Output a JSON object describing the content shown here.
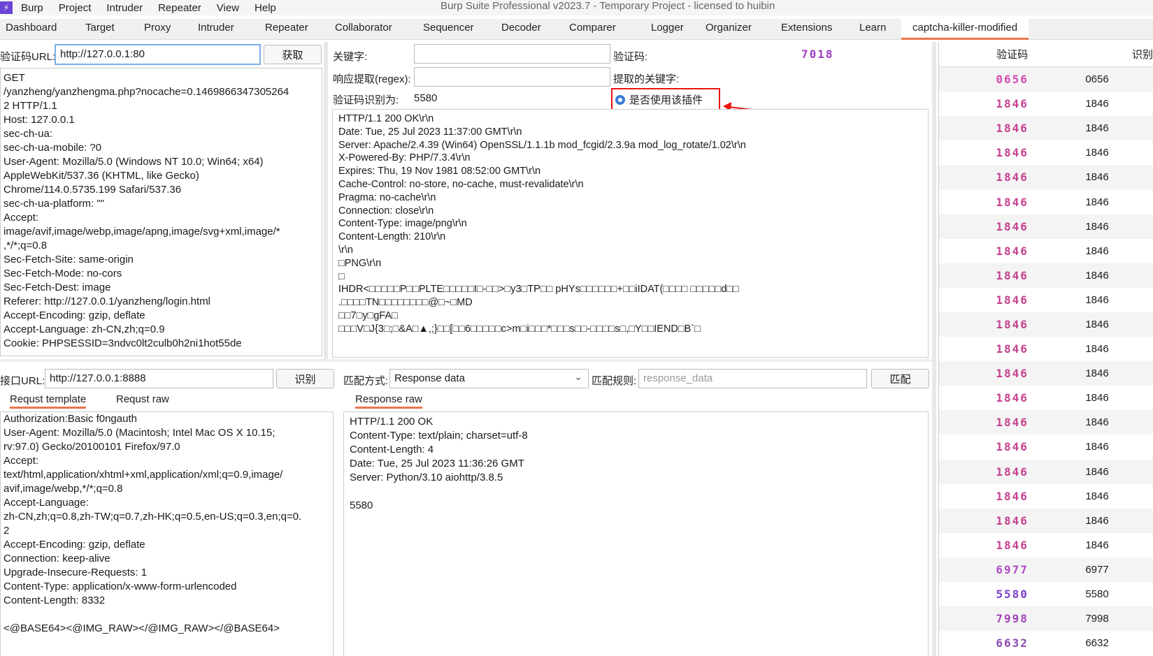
{
  "window_title": "Burp Suite Professional v2023.7 - Temporary Project - licensed to huibin",
  "menu": [
    "Burp",
    "Project",
    "Intruder",
    "Repeater",
    "View",
    "Help"
  ],
  "tabs": [
    "Dashboard",
    "Target",
    "Proxy",
    "Intruder",
    "Repeater",
    "Collaborator",
    "Sequencer",
    "Decoder",
    "Comparer",
    "Logger",
    "Organizer",
    "Extensions",
    "Learn",
    "captcha-killer-modified"
  ],
  "captcha_panel": {
    "url_label": "验证码URL:",
    "url_value": "http://127.0.0.1:80",
    "fetch_button": "获取",
    "request_text": "GET\n/yanzheng/yanzhengma.php?nocache=0.1469866347305264\n2 HTTP/1.1\nHost: 127.0.0.1\nsec-ch-ua:\nsec-ch-ua-mobile: ?0\nUser-Agent: Mozilla/5.0 (Windows NT 10.0; Win64; x64)\nAppleWebKit/537.36 (KHTML, like Gecko)\nChrome/114.0.5735.199 Safari/537.36\nsec-ch-ua-platform: \"\"\nAccept:\nimage/avif,image/webp,image/apng,image/svg+xml,image/*\n,*/*;q=0.8\nSec-Fetch-Site: same-origin\nSec-Fetch-Mode: no-cors\nSec-Fetch-Dest: image\nReferer: http://127.0.0.1/yanzheng/login.html\nAccept-Encoding: gzip, deflate\nAccept-Language: zh-CN,zh;q=0.9\nCookie: PHPSESSID=3ndvc0lt2culb0h2ni1hot55de"
  },
  "keyword_panel": {
    "keyword_label": "关键字:",
    "keyword_value": "",
    "captcha_label": "验证码:",
    "captcha_image_text": "7018",
    "regex_label": "响应提取(regex):",
    "regex_value": "",
    "extracted_label": "提取的关键字:",
    "recognized_label": "验证码识别为:",
    "recognized_value": "5580",
    "use_plugin_label": "是否使用该插件",
    "response_text": "HTTP/1.1 200 OK\\r\\n\nDate: Tue, 25 Jul 2023 11:37:00 GMT\\r\\n\nServer: Apache/2.4.39 (Win64) OpenSSL/1.1.1b mod_fcgid/2.3.9a mod_log_rotate/1.02\\r\\n\nX-Powered-By: PHP/7.3.4\\r\\n\nExpires: Thu, 19 Nov 1981 08:52:00 GMT\\r\\n\nCache-Control: no-store, no-cache, must-revalidate\\r\\n\nPragma: no-cache\\r\\n\nConnection: close\\r\\n\nContent-Type: image/png\\r\\n\nContent-Length: 210\\r\\n\n\\r\\n\n□PNG\\r\\n\n□\nIHDR<□□□□□P□□PLTE□□□□□I□-□□>□y3□TP□□ pHYs□□□□□□+□□iIDAT(□□□□ □□□□□d□□\n.□□□□TN□□□□□□□□@□~□MD\n□□7□y□gFA□\n□□□V□J{3□;□&A□▲,;}□□[□□6□□□□□c>m□i□□□*□□□s□□-□□□□s□,□Y□□IEND□B`□"
  },
  "api_panel": {
    "url_label": "接口URL:",
    "url_value": "http://127.0.0.1:8888",
    "recognize_button": "识别",
    "tab_template": "Requst template",
    "tab_raw": "Requst raw",
    "template_text": "Authorization:Basic f0ngauth\nUser-Agent: Mozilla/5.0 (Macintosh; Intel Mac OS X 10.15;\nrv:97.0) Gecko/20100101 Firefox/97.0\nAccept:\ntext/html,application/xhtml+xml,application/xml;q=0.9,image/\navif,image/webp,*/*;q=0.8\nAccept-Language:\nzh-CN,zh;q=0.8,zh-TW;q=0.7,zh-HK;q=0.5,en-US;q=0.3,en;q=0.\n2\nAccept-Encoding: gzip, deflate\nConnection: keep-alive\nUpgrade-Insecure-Requests: 1\nContent-Type: application/x-www-form-urlencoded\nContent-Length: 8332\n\n<@BASE64><@IMG_RAW></@IMG_RAW></@BASE64>"
  },
  "match_panel": {
    "match_mode_label": "匹配方式:",
    "match_mode_value": "Response data",
    "match_rule_label": "匹配规则:",
    "match_rule_placeholder": "response_data",
    "match_button": "匹配",
    "tab_response_raw": "Response raw",
    "response_text": "HTTP/1.1 200 OK\nContent-Type: text/plain; charset=utf-8\nContent-Length: 4\nDate: Tue, 25 Jul 2023 11:36:26 GMT\nServer: Python/3.10 aiohttp/3.8.5\n\n5580"
  },
  "history_table": {
    "col_captcha": "验证码",
    "col_result": "识别",
    "rows": [
      {
        "img": "0656",
        "val": "0656",
        "color": "#d44ab0"
      },
      {
        "img": "1846",
        "val": "1846",
        "color": "#c5408f"
      },
      {
        "img": "1846",
        "val": "1846",
        "color": "#c5408f"
      },
      {
        "img": "1846",
        "val": "1846",
        "color": "#c5408f"
      },
      {
        "img": "1846",
        "val": "1846",
        "color": "#c5408f"
      },
      {
        "img": "1846",
        "val": "1846",
        "color": "#c5408f"
      },
      {
        "img": "1846",
        "val": "1846",
        "color": "#c5408f"
      },
      {
        "img": "1846",
        "val": "1846",
        "color": "#c5408f"
      },
      {
        "img": "1846",
        "val": "1846",
        "color": "#c5408f"
      },
      {
        "img": "1846",
        "val": "1846",
        "color": "#c5408f"
      },
      {
        "img": "1846",
        "val": "1846",
        "color": "#c5408f"
      },
      {
        "img": "1846",
        "val": "1846",
        "color": "#c5408f"
      },
      {
        "img": "1846",
        "val": "1846",
        "color": "#c5408f"
      },
      {
        "img": "1846",
        "val": "1846",
        "color": "#c5408f"
      },
      {
        "img": "1846",
        "val": "1846",
        "color": "#c5408f"
      },
      {
        "img": "1846",
        "val": "1846",
        "color": "#c5408f"
      },
      {
        "img": "1846",
        "val": "1846",
        "color": "#c5408f"
      },
      {
        "img": "1846",
        "val": "1846",
        "color": "#c5408f"
      },
      {
        "img": "1846",
        "val": "1846",
        "color": "#c5408f"
      },
      {
        "img": "1846",
        "val": "1846",
        "color": "#c5408f"
      },
      {
        "img": "6977",
        "val": "6977",
        "color": "#b04cc4"
      },
      {
        "img": "5580",
        "val": "5580",
        "color": "#7a3fc8"
      },
      {
        "img": "7998",
        "val": "7998",
        "color": "#a045b8"
      },
      {
        "img": "6632",
        "val": "6632",
        "color": "#8a4ab0"
      }
    ]
  },
  "colors": {
    "accent": "#e8764b",
    "annotation": "#e11111",
    "radio": "#3b7bd8",
    "captcha_main": "#9b3fc0"
  }
}
